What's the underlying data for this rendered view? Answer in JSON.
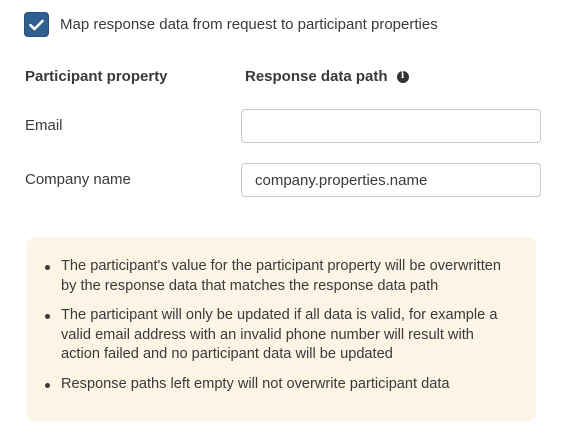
{
  "mapping": {
    "checkbox_label": "Map response data from request to participant properties",
    "checked": true
  },
  "columns": {
    "property_header": "Participant property",
    "path_header": "Response data path",
    "info_icon": "info-icon"
  },
  "rows": [
    {
      "label": "Email",
      "value": "",
      "placeholder": ""
    },
    {
      "label": "Company name",
      "value": "company.properties.name",
      "placeholder": ""
    }
  ],
  "notes": [
    "The participant's value for the participant property will be overwritten by the response data that matches the response data path",
    "The participant will only be updated if all data is valid, for example a valid email address with an invalid phone number will result with action failed and no participant data will be updated",
    "Response paths left empty will not overwrite participant data"
  ],
  "colors": {
    "checkbox": "#2f5f8f",
    "info_background": "#fcf5e6"
  }
}
